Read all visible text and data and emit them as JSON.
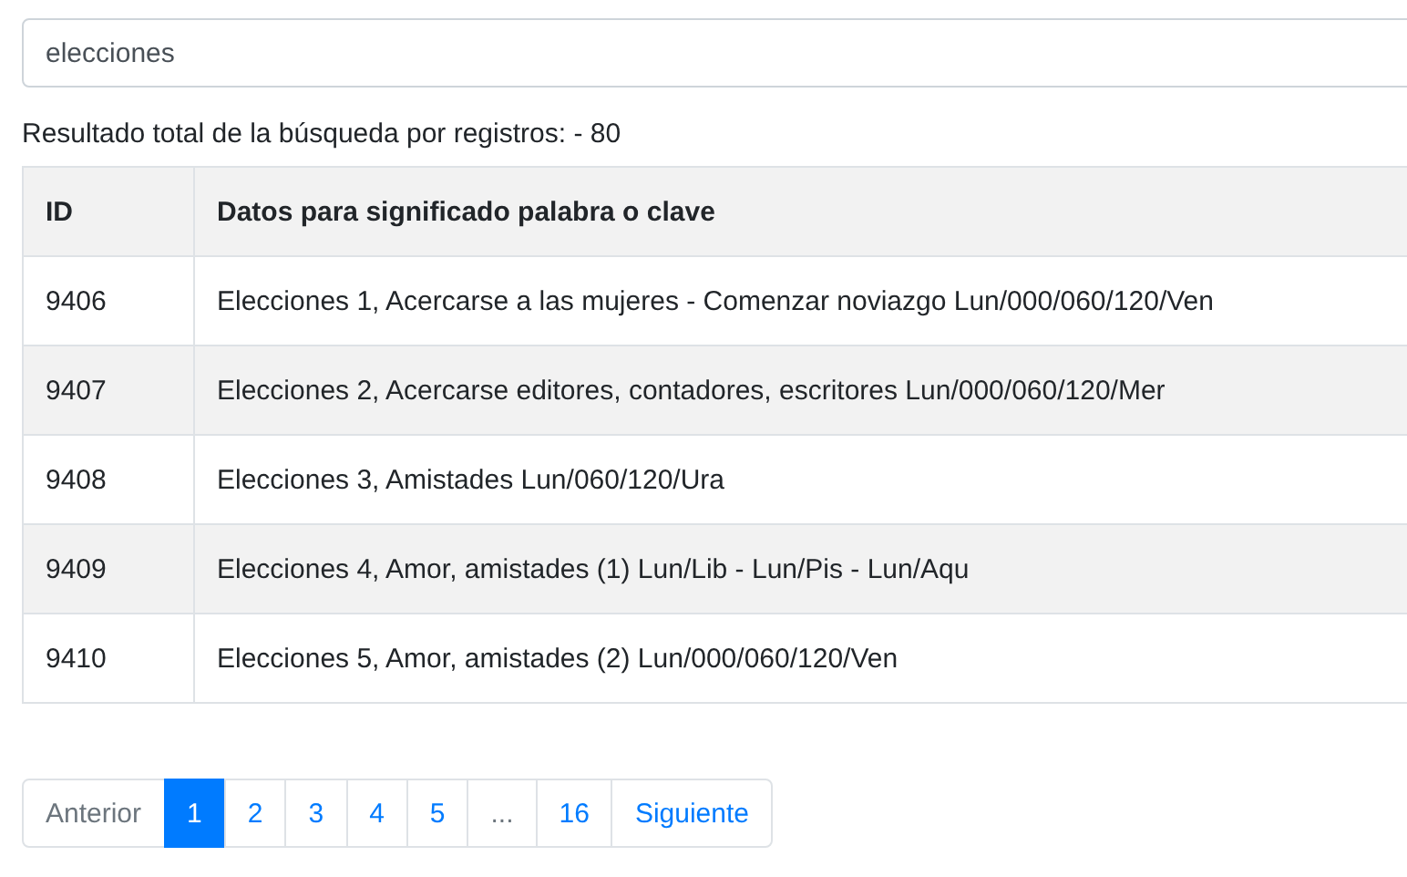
{
  "search": {
    "value": "elecciones"
  },
  "result_summary": "Resultado total de la búsqueda por registros: - 80",
  "table": {
    "columns": [
      "ID",
      "Datos para significado palabra o clave"
    ],
    "rows": [
      {
        "cells": [
          "9406",
          "Elecciones 1, Acercarse a las mujeres - Comenzar noviazgo Lun/000/060/120/Ven"
        ]
      },
      {
        "cells": [
          "9407",
          "Elecciones 2, Acercarse editores, contadores, escritores Lun/000/060/120/Mer"
        ]
      },
      {
        "cells": [
          "9408",
          "Elecciones 3, Amistades Lun/060/120/Ura"
        ]
      },
      {
        "cells": [
          "9409",
          "Elecciones 4, Amor, amistades (1) Lun/Lib - Lun/Pis - Lun/Aqu"
        ]
      },
      {
        "cells": [
          "9410",
          "Elecciones 5, Amor, amistades (2) Lun/000/060/120/Ven"
        ]
      }
    ]
  },
  "pagination": [
    {
      "label": "Anterior",
      "selected": false,
      "disabled": true
    },
    {
      "label": "1",
      "selected": true,
      "disabled": false
    },
    {
      "label": "2",
      "selected": false,
      "disabled": false
    },
    {
      "label": "3",
      "selected": false,
      "disabled": false
    },
    {
      "label": "4",
      "selected": false,
      "disabled": false
    },
    {
      "label": "5",
      "selected": false,
      "disabled": false
    },
    {
      "label": "...",
      "selected": false,
      "disabled": true
    },
    {
      "label": "16",
      "selected": false,
      "disabled": false
    },
    {
      "label": "Siguiente",
      "selected": false,
      "disabled": false
    }
  ]
}
